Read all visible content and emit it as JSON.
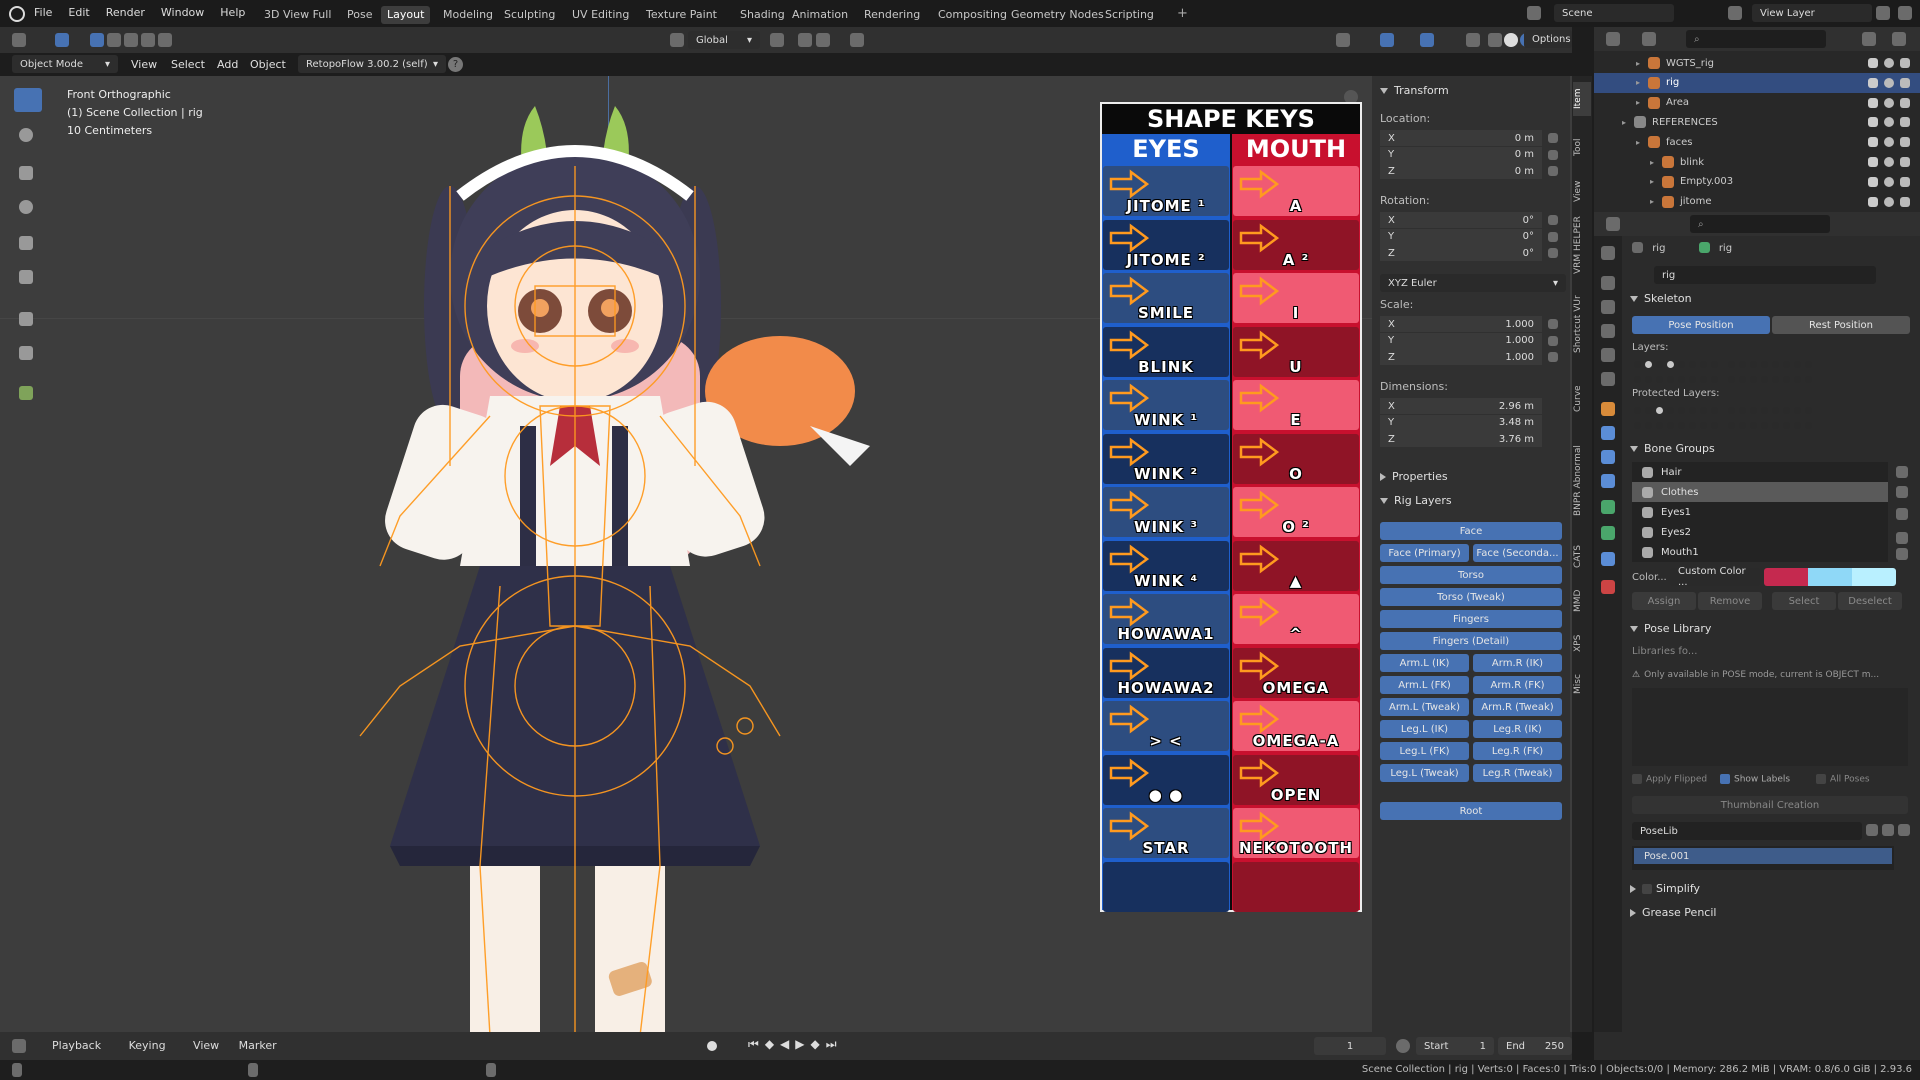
{
  "menu": [
    "File",
    "Edit",
    "Render",
    "Window",
    "Help"
  ],
  "workspace_tabs": [
    "3D View Full",
    "Pose",
    "Layout",
    "Modeling",
    "Sculpting",
    "UV Editing",
    "Texture Paint",
    "Shading",
    "Animation",
    "Rendering",
    "Compositing",
    "Geometry Nodes",
    "Scripting"
  ],
  "active_workspace": "Layout",
  "scene": {
    "name": "Scene",
    "view_layer": "View Layer"
  },
  "viewport_header": {
    "mode": "Object Mode",
    "menus": [
      "View",
      "Select",
      "Add",
      "Object"
    ],
    "addon": "RetopoFlow 3.00.2 (self)",
    "transform_orientation": "Global",
    "options_label": "Options"
  },
  "viewport_info": {
    "line1": "Front Orthographic",
    "line2": "(1) Scene Collection | rig",
    "line3": "10 Centimeters"
  },
  "shape_keys": {
    "title": "SHAPE KEYS",
    "eyes_header": "EYES",
    "mouth_header": "MOUTH",
    "eyes": [
      "JITOME ¹",
      "JITOME ²",
      "SMILE",
      "BLINK",
      "WINK ¹",
      "WINK ²",
      "WINK ³",
      "WINK ⁴",
      "HOWAWA1",
      "HOWAWA2",
      "> <",
      "● ●",
      "STAR",
      ""
    ],
    "mouth": [
      "A",
      "A ²",
      "I",
      "U",
      "E",
      "O",
      "O ²",
      "▲",
      "^",
      "OMEGA",
      "OMEGA-A",
      "OPEN",
      "NEKOTOOTH",
      ""
    ]
  },
  "transform": {
    "title": "Transform",
    "location_label": "Location:",
    "location": [
      [
        "X",
        "0 m"
      ],
      [
        "Y",
        "0 m"
      ],
      [
        "Z",
        "0 m"
      ]
    ],
    "rotation_label": "Rotation:",
    "rotation": [
      [
        "X",
        "0°"
      ],
      [
        "Y",
        "0°"
      ],
      [
        "Z",
        "0°"
      ]
    ],
    "rotation_mode": "XYZ Euler",
    "scale_label": "Scale:",
    "scale": [
      [
        "X",
        "1.000"
      ],
      [
        "Y",
        "1.000"
      ],
      [
        "Z",
        "1.000"
      ]
    ],
    "dimensions_label": "Dimensions:",
    "dimensions": [
      [
        "X",
        "2.96 m"
      ],
      [
        "Y",
        "3.48 m"
      ],
      [
        "Z",
        "3.76 m"
      ]
    ],
    "properties_label": "Properties",
    "rig_layers_label": "Rig Layers"
  },
  "rig_layers": {
    "face": "Face",
    "face_primary": "Face (Primary)",
    "face_secondary": "Face (Seconda...",
    "torso": "Torso",
    "torso_tweak": "Torso (Tweak)",
    "fingers": "Fingers",
    "fingers_detail": "Fingers (Detail)",
    "pairs": [
      [
        "Arm.L (IK)",
        "Arm.R (IK)"
      ],
      [
        "Arm.L (FK)",
        "Arm.R (FK)"
      ],
      [
        "Arm.L (Tweak)",
        "Arm.R (Tweak)"
      ],
      [
        "Leg.L (IK)",
        "Leg.R (IK)"
      ],
      [
        "Leg.L (FK)",
        "Leg.R (FK)"
      ],
      [
        "Leg.L (Tweak)",
        "Leg.R (Tweak)"
      ]
    ],
    "root": "Root"
  },
  "side_tabs": [
    "Item",
    "Tool",
    "View",
    "VRM HELPER",
    "Shortcut VUr",
    "Curve",
    "BNPR Abnormal",
    "CATS",
    "MMD",
    "XPS",
    "Misc"
  ],
  "outliner": [
    {
      "name": "WGTS_rig",
      "indent": 3
    },
    {
      "name": "rig",
      "indent": 3,
      "selected": true
    },
    {
      "name": "Area",
      "indent": 3
    },
    {
      "name": "REFERENCES",
      "indent": 2
    },
    {
      "name": "faces",
      "indent": 3
    },
    {
      "name": "blink",
      "indent": 4
    },
    {
      "name": "Empty.003",
      "indent": 4
    },
    {
      "name": "jitome",
      "indent": 4
    }
  ],
  "properties": {
    "object_name": "rig",
    "data_name": "rig",
    "datablock": "rig",
    "skeleton_label": "Skeleton",
    "pose_position": "Pose Position",
    "rest_position": "Rest Position",
    "layers_label": "Layers:",
    "protected_layers_label": "Protected Layers:",
    "bone_groups_label": "Bone Groups",
    "bone_groups": [
      "Hair",
      "Clothes",
      "Eyes1",
      "Eyes2",
      "Mouth1"
    ],
    "selected_bone_group": "Clothes",
    "color_label": "Color...",
    "color_set": "Custom Color ...",
    "swatch_colors": [
      "#c5294f",
      "#8fd8f7",
      "#b9f0ff"
    ],
    "group_buttons": [
      "Assign",
      "Remove",
      "Select",
      "Deselect"
    ],
    "pose_library_label": "Pose Library",
    "libraries_for": "Libraries fo...",
    "pose_warning": "Only available in POSE mode, current is OBJECT m...",
    "apply_flipped": "Apply Flipped",
    "show_labels": "Show Labels",
    "all_poses": "All Poses",
    "thumbnail_creation": "Thumbnail Creation",
    "poselib": "PoseLib",
    "pose_item": "Pose.001",
    "simplify": "Simplify",
    "grease_pencil": "Grease Pencil"
  },
  "timeline": {
    "menus": [
      "Playback",
      "Keying",
      "View",
      "Marker"
    ],
    "current_frame": "1",
    "start_label": "Start",
    "start": "1",
    "end_label": "End",
    "end": "250"
  },
  "status_bar": "Scene Collection | rig | Verts:0 | Faces:0 | Tris:0 | Objects:0/0 | Memory: 286.2 MiB | VRAM: 0.8/6.0 GiB | 2.93.6",
  "colors": {
    "accent": "#4772b3",
    "eyes_blue": "#1f5fcc",
    "mouth_red": "#c8102e",
    "rig_orange": "#ff9a1f"
  }
}
